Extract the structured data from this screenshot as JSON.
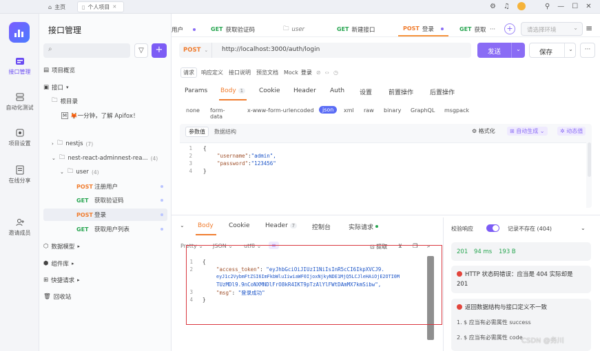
{
  "window": {
    "home_tab": "主页",
    "project_tab": "个人项目",
    "close_glyph": "✕"
  },
  "rail": {
    "items": [
      {
        "label": "接口管理"
      },
      {
        "label": "自动化测试"
      },
      {
        "label": "项目设置"
      },
      {
        "label": "在线分享"
      },
      {
        "label": "邀请成员"
      }
    ]
  },
  "sidebar": {
    "title": "接口管理",
    "add": "+",
    "overview": "项目概览",
    "api_root": "接口",
    "root_dir": "根目录",
    "intro_item": "🦊一分钟，了解 Apifox！",
    "nestjs_folder": "nestjs",
    "nestjs_count": "(7)",
    "nrs_folder": "nest-react-adminnest-rea...",
    "nrs_count": "(4)",
    "user_folder": "user",
    "user_count": "(4)",
    "endpoints": [
      {
        "method": "POST",
        "name": "注册用户"
      },
      {
        "method": "GET",
        "name": "获取验证码"
      },
      {
        "method": "POST",
        "name": "登录"
      },
      {
        "method": "GET",
        "name": "获取用户列表"
      }
    ],
    "data_models": "数据模型",
    "components": "组件库",
    "quick_requests": "快捷请求",
    "recycle": "回收站"
  },
  "tabs": {
    "items": [
      {
        "method": "",
        "label": "用户"
      },
      {
        "method": "GET",
        "label": "获取验证码"
      },
      {
        "method": "",
        "label": "user"
      },
      {
        "method": "GET",
        "label": "新建接口"
      },
      {
        "method": "POST",
        "label": "登录"
      },
      {
        "method": "GET",
        "label": "获取"
      }
    ],
    "more": "···",
    "env_placeholder": "请选择环境",
    "menu_glyph": "≡"
  },
  "request": {
    "method": "POST",
    "url": "http://localhost:3000/auth/login",
    "send": "发送",
    "save": "保存",
    "more": "···"
  },
  "modes": [
    "请求",
    "响应定义",
    "接口说明",
    "预览文档",
    "Mock",
    "登录"
  ],
  "param_tabs": {
    "items": [
      "Params",
      "Body",
      "Cookie",
      "Header",
      "Auth",
      "设置",
      "前置操作",
      "后置操作"
    ],
    "body_count": "1"
  },
  "body_types": [
    "none",
    "form-data",
    "x-www-form-urlencoded",
    "json",
    "xml",
    "raw",
    "binary",
    "GraphQL",
    "msgpack"
  ],
  "editor": {
    "tab_params": "参数值",
    "tab_structure": "数据结构",
    "format": "格式化",
    "autogen": "自动生成",
    "dynamic": "动态值",
    "lines": [
      {
        "n": "1",
        "text": "{"
      },
      {
        "n": "2",
        "key": "\"username\"",
        "sep": ":",
        "val": "\"admin\","
      },
      {
        "n": "3",
        "key": "\"password\"",
        "sep": ":",
        "val": "\"123456\""
      },
      {
        "n": "4",
        "text": "}"
      }
    ]
  },
  "response": {
    "tabs": [
      "Body",
      "Cookie",
      "Header",
      "控制台",
      "实际请求"
    ],
    "header_count": "7",
    "format": "Pretty",
    "lang": "JSON",
    "encoding": "utf8",
    "extract": "提取",
    "lines": [
      {
        "n": "1",
        "text": "{"
      },
      {
        "n": "2",
        "key": "\"access_token\"",
        "sep": ": ",
        "val": "\"eyJhbGciOiJIUzI1NiIsInR5cCI6IkpXVCJ9."
      },
      {
        "n": "",
        "val": "eyJ1c2VybmFtZSI6ImFkbWluIiwiaWF0IjoxNjkyNDE1MjQ5LCJleHAiOjE2OTI0M"
      },
      {
        "n": "",
        "val": "TUzMDl9.9nCoNXMNDlFrO8kR4IKT9pTzAlYlFWtDAmMX7kmSibw\","
      },
      {
        "n": "3",
        "key": "\"msg\"",
        "sep": ": ",
        "val": "\"登录成功\""
      },
      {
        "n": "4",
        "text": "}"
      }
    ]
  },
  "validation": {
    "label": "校验响应",
    "note": "记录不存在 (404)",
    "status": "201",
    "time": "94 ms",
    "size": "193 B",
    "error1": "HTTP 状态码错误：应当是 404 实际却是 201",
    "error2": "返回数据结构与接口定义不一致",
    "detail1": "1. $ 应当有必需属性 success",
    "detail2": "2. $ 应当有必需属性 code"
  },
  "watermark": "CSDN @务川",
  "colors": {
    "accent": "#7c5cf5",
    "post": "#f07c2e",
    "get": "#27a550",
    "error": "#e2453c",
    "highlight_box": "#d9363e"
  }
}
